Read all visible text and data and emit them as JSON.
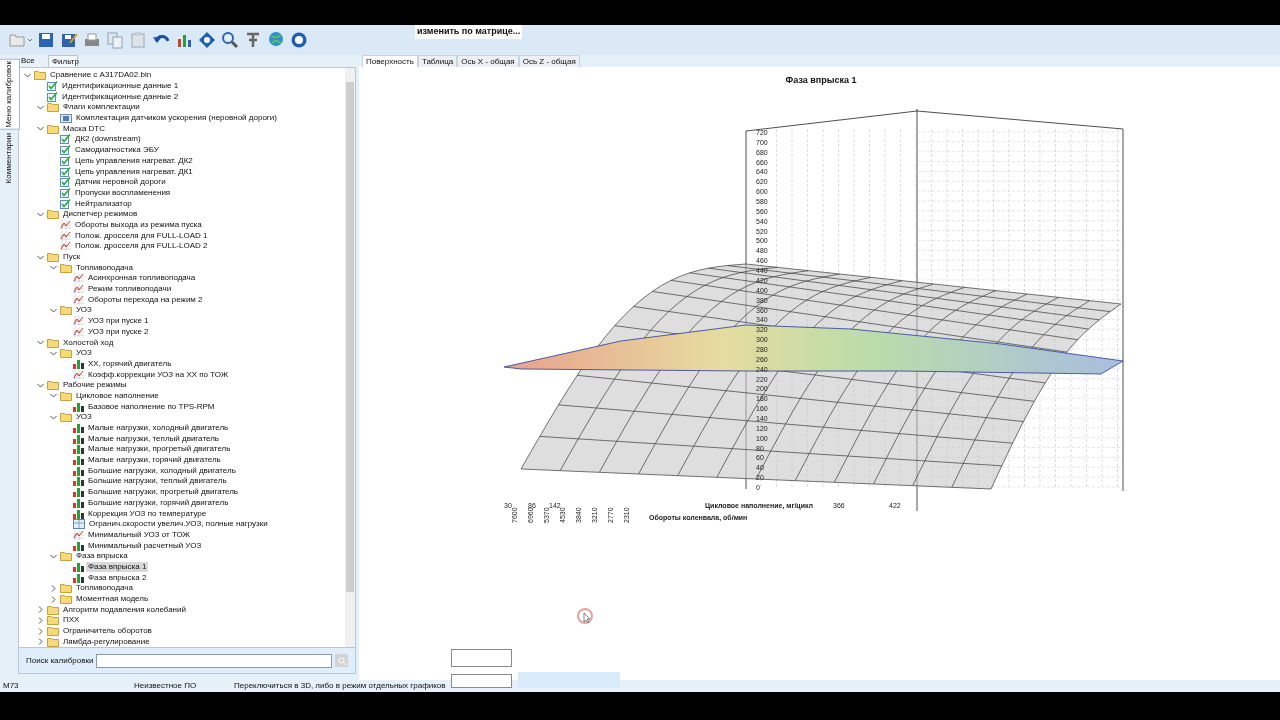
{
  "popup_hint": "изменить по матрице...",
  "side_tabs": [
    {
      "label": "Меню калибровок",
      "selected": true
    },
    {
      "label": "Комментарии",
      "selected": false
    }
  ],
  "panel_tabs": [
    {
      "label": "Все",
      "selected": false
    },
    {
      "label": "Фильтр",
      "selected": true
    }
  ],
  "tree": [
    {
      "label": "Сравнение с A317DA02.bin",
      "kind": "folder",
      "expanded": true,
      "selected": false,
      "children": [
        {
          "label": "Идентификационные данные 1",
          "kind": "check",
          "selected": false
        },
        {
          "label": "Идентификационные данные 2",
          "kind": "check",
          "selected": false
        },
        {
          "label": "Флаги комплектации",
          "kind": "folder",
          "expanded": true,
          "selected": false,
          "children": [
            {
              "label": "Комплектация датчиком ускорения (неровной дороги)",
              "kind": "value",
              "selected": false
            }
          ]
        },
        {
          "label": "Маска DTC",
          "kind": "folder",
          "expanded": true,
          "selected": false,
          "children": [
            {
              "label": "ДК2 (downstream)",
              "kind": "check",
              "selected": false
            },
            {
              "label": "Самодиагностика ЭБУ",
              "kind": "check",
              "selected": false
            },
            {
              "label": "Цепь управления нагреват. ДК2",
              "kind": "check",
              "selected": false
            },
            {
              "label": "Цепь управления нагреват. ДК1",
              "kind": "check",
              "selected": false
            },
            {
              "label": "Датчик неровной дороги",
              "kind": "check",
              "selected": false
            },
            {
              "label": "Пропуски воспламенения",
              "kind": "check",
              "selected": false
            },
            {
              "label": "Нейтрализатор",
              "kind": "check",
              "selected": false
            }
          ]
        },
        {
          "label": "Диспетчер режимов",
          "kind": "folder",
          "expanded": true,
          "selected": false,
          "children": [
            {
              "label": "Обороты выхода из режима пуска",
              "kind": "curve",
              "selected": false
            },
            {
              "label": "Полож. дросселя для FULL-LOAD 1",
              "kind": "curve",
              "selected": false
            },
            {
              "label": "Полож. дросселя для FULL-LOAD 2",
              "kind": "curve",
              "selected": false
            }
          ]
        },
        {
          "label": "Пуск",
          "kind": "folder",
          "expanded": true,
          "selected": false,
          "children": [
            {
              "label": "Топливоподача",
              "kind": "folder",
              "expanded": true,
              "selected": false,
              "children": [
                {
                  "label": "Асинхронная топливоподача",
                  "kind": "curve",
                  "selected": false
                },
                {
                  "label": "Режим топливоподачи",
                  "kind": "curve",
                  "selected": false
                },
                {
                  "label": "Обороты перехода на режим 2",
                  "kind": "curve",
                  "selected": false
                }
              ]
            },
            {
              "label": "УОЗ",
              "kind": "folder",
              "expanded": true,
              "selected": false,
              "children": [
                {
                  "label": "УОЗ при пуске 1",
                  "kind": "curve",
                  "selected": false
                },
                {
                  "label": "УОЗ при пуске 2",
                  "kind": "curve",
                  "selected": false
                }
              ]
            }
          ]
        },
        {
          "label": "Холостой ход",
          "kind": "folder",
          "expanded": true,
          "selected": false,
          "children": [
            {
              "label": "УОЗ",
              "kind": "folder",
              "expanded": true,
              "selected": false,
              "children": [
                {
                  "label": "ХХ, горячий двигатель",
                  "kind": "map",
                  "selected": false
                },
                {
                  "label": "Коэфф.коррекции УОЗ на ХХ по ТОЖ",
                  "kind": "curve",
                  "selected": false
                }
              ]
            }
          ]
        },
        {
          "label": "Рабочие режимы",
          "kind": "folder",
          "expanded": true,
          "selected": false,
          "children": [
            {
              "label": "Цикловое наполнение",
              "kind": "folder",
              "expanded": true,
              "selected": false,
              "children": [
                {
                  "label": "Базовое наполнение по TPS-RPM",
                  "kind": "map",
                  "selected": false
                }
              ]
            },
            {
              "label": "УОЗ",
              "kind": "folder",
              "expanded": true,
              "selected": false,
              "children": [
                {
                  "label": "Малые нагрузки, холодный двигатель",
                  "kind": "map",
                  "selected": false
                },
                {
                  "label": "Малые нагрузки, теплый двигатель",
                  "kind": "map",
                  "selected": false
                },
                {
                  "label": "Малые нагрузки, прогретый двигатель",
                  "kind": "map",
                  "selected": false
                },
                {
                  "label": "Малые нагрузки, горячий двигатель",
                  "kind": "map",
                  "selected": false
                },
                {
                  "label": "Большие нагрузки, холодный двигатель",
                  "kind": "map",
                  "selected": false
                },
                {
                  "label": "Большие нагрузки, теплый двигатель",
                  "kind": "map",
                  "selected": false
                },
                {
                  "label": "Большие нагрузки, прогретый двигатель",
                  "kind": "map",
                  "selected": false
                },
                {
                  "label": "Большие нагрузки, горячий двигатель",
                  "kind": "map",
                  "selected": false
                },
                {
                  "label": "Коррекция УОЗ по температуре",
                  "kind": "map",
                  "selected": false
                },
                {
                  "label": "Огранич.скорости увелич.УОЗ, полные нагрузки",
                  "kind": "table",
                  "selected": false
                },
                {
                  "label": "Минимальный УОЗ от ТОЖ",
                  "kind": "curve",
                  "selected": false
                },
                {
                  "label": "Минимальный расчетный УОЗ",
                  "kind": "map",
                  "selected": false
                }
              ]
            },
            {
              "label": "Фаза впрыска",
              "kind": "folder",
              "expanded": true,
              "selected": false,
              "children": [
                {
                  "label": "Фаза впрыска 1",
                  "kind": "map",
                  "selected": true
                },
                {
                  "label": "Фаза впрыска 2",
                  "kind": "map",
                  "selected": false
                }
              ]
            },
            {
              "label": "Топливоподача",
              "kind": "folder",
              "expanded": false,
              "selected": false
            },
            {
              "label": "Моментная модель",
              "kind": "folder",
              "expanded": false,
              "selected": false
            }
          ]
        },
        {
          "label": "Алгоритм подавления колебаний",
          "kind": "folder",
          "expanded": false,
          "selected": false
        },
        {
          "label": "ПХХ",
          "kind": "folder",
          "expanded": false,
          "selected": false
        },
        {
          "label": "Ограничитель оборотов",
          "kind": "folder",
          "expanded": false,
          "selected": false
        },
        {
          "label": "Лямбда-регулирование",
          "kind": "folder",
          "expanded": false,
          "selected": false
        }
      ]
    }
  ],
  "search": {
    "label": "Поиск калибровки"
  },
  "view_tabs": [
    {
      "label": "Поверхность",
      "selected": true
    },
    {
      "label": "Таблица",
      "selected": false
    },
    {
      "label": "Ось X - общая",
      "selected": false
    },
    {
      "label": "Ось Z - общая",
      "selected": false
    }
  ],
  "chart": {
    "title": "Фаза впрыска 1",
    "z_ticks": [
      "720",
      "700",
      "680",
      "660",
      "640",
      "620",
      "600",
      "580",
      "560",
      "540",
      "520",
      "500",
      "480",
      "460",
      "440",
      "420",
      "400",
      "380",
      "360",
      "340",
      "320",
      "300",
      "280",
      "260",
      "240",
      "220",
      "200",
      "180",
      "160",
      "140",
      "120",
      "100",
      "80",
      "60",
      "40",
      "20",
      "0"
    ],
    "rpm_ticks": [
      "7600",
      "6960",
      "5370",
      "4530",
      "3840",
      "3210",
      "2770",
      "2310"
    ],
    "fill_ticks": [
      "30",
      "86",
      "142",
      "366",
      "422"
    ],
    "fill_axis_label": "Цикловое наполнение, мг/цикл",
    "rpm_axis_label": "Обороты коленвала, об/мин"
  },
  "status_bar": [
    "M73",
    "Неизвестное ПО",
    "Переключиться в 3D, либо в режим отдельных графиков"
  ]
}
